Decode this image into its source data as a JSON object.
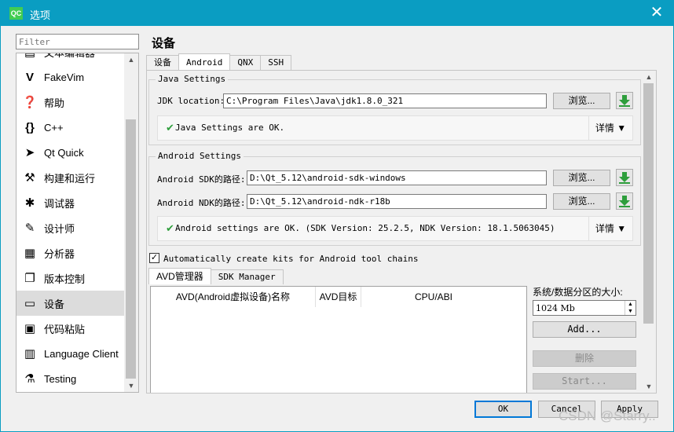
{
  "window": {
    "title": "选项",
    "icon": "QC"
  },
  "filter": {
    "placeholder": "Filter"
  },
  "sidebar": {
    "items": [
      {
        "label": "文本编辑器",
        "icon": "text-editor-icon",
        "glyph": "▤"
      },
      {
        "label": "FakeVim",
        "icon": "fakevim-icon",
        "glyph": "V"
      },
      {
        "label": "帮助",
        "icon": "help-icon",
        "glyph": "❓"
      },
      {
        "label": "C++",
        "icon": "cpp-icon",
        "glyph": "{}"
      },
      {
        "label": "Qt Quick",
        "icon": "qt-quick-icon",
        "glyph": "➤"
      },
      {
        "label": "构建和运行",
        "icon": "hammer-icon",
        "glyph": "⚒"
      },
      {
        "label": "调试器",
        "icon": "bug-icon",
        "glyph": "✱"
      },
      {
        "label": "设计师",
        "icon": "pen-icon",
        "glyph": "✎"
      },
      {
        "label": "分析器",
        "icon": "analyzer-icon",
        "glyph": "▦"
      },
      {
        "label": "版本控制",
        "icon": "version-control-icon",
        "glyph": "❐"
      },
      {
        "label": "设备",
        "icon": "device-icon",
        "glyph": "▭",
        "selected": true
      },
      {
        "label": "代码粘贴",
        "icon": "code-paste-icon",
        "glyph": "▣"
      },
      {
        "label": "Language Client",
        "icon": "language-client-icon",
        "glyph": "▥"
      },
      {
        "label": "Testing",
        "icon": "testing-icon",
        "glyph": "⚗"
      }
    ]
  },
  "page": {
    "title": "设备"
  },
  "tabs": [
    "设备",
    "Android",
    "QNX",
    "SSH"
  ],
  "java": {
    "group_title": "Java Settings",
    "jdk_label": "JDK location:",
    "jdk_value": "C:\\Program Files\\Java\\jdk1.8.0_321",
    "browse": "浏览...",
    "status": "Java Settings are OK.",
    "details": "详情 ▼"
  },
  "android": {
    "group_title": "Android Settings",
    "sdk_label": "Android SDK的路径:",
    "sdk_value": "D:\\Qt_5.12\\android-sdk-windows",
    "ndk_label": "Android NDK的路径:",
    "ndk_value": "D:\\Qt_5.12\\android-ndk-r18b",
    "browse": "浏览...",
    "status": "Android settings are OK. (SDK Version: 25.2.5, NDK Version: 18.1.5063045)",
    "details": "详情 ▼"
  },
  "auto_kits": {
    "label": "Automatically create kits for Android tool chains",
    "checked": true
  },
  "subtabs": [
    "AVD管理器",
    "SDK Manager"
  ],
  "avd": {
    "columns": [
      "AVD(Android虚拟设备)名称",
      "AVD目标",
      "CPU/ABI"
    ],
    "partition_label": "系统/数据分区的大小:",
    "partition_value": "1024 Mb",
    "add": "Add...",
    "delete": "删除",
    "start": "Start..."
  },
  "buttons": {
    "ok": "OK",
    "cancel": "Cancel",
    "apply": "Apply"
  },
  "watermark": "CSDN @Starry.."
}
